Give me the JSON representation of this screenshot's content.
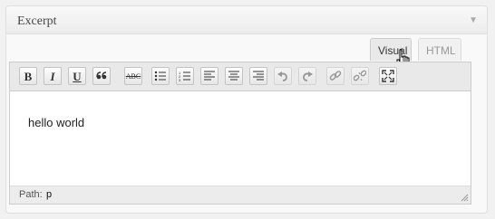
{
  "panel": {
    "title": "Excerpt",
    "toggle_icon": "triangle-down-icon"
  },
  "tabs": {
    "visual": "Visual",
    "html": "HTML",
    "active": "visual"
  },
  "toolbar": {
    "bold": "B",
    "italic": "I",
    "underline": "U",
    "blockquote": "66",
    "strikethrough": "ABC",
    "icons": [
      "bold-icon",
      "italic-icon",
      "underline-icon",
      "blockquote-icon",
      "strikethrough-icon",
      "bullet-list-icon",
      "numbered-list-icon",
      "align-left-icon",
      "align-center-icon",
      "align-right-icon",
      "undo-icon",
      "redo-icon",
      "link-icon",
      "unlink-icon",
      "fullscreen-icon"
    ]
  },
  "editor": {
    "content": "hello world"
  },
  "statusbar": {
    "path_label": "Path:",
    "path_value": "p"
  },
  "colors": {
    "background": "#f1f1f1",
    "panel": "#f9f9f9",
    "toolbar": "#e9e9e9",
    "border": "#cccccc"
  }
}
